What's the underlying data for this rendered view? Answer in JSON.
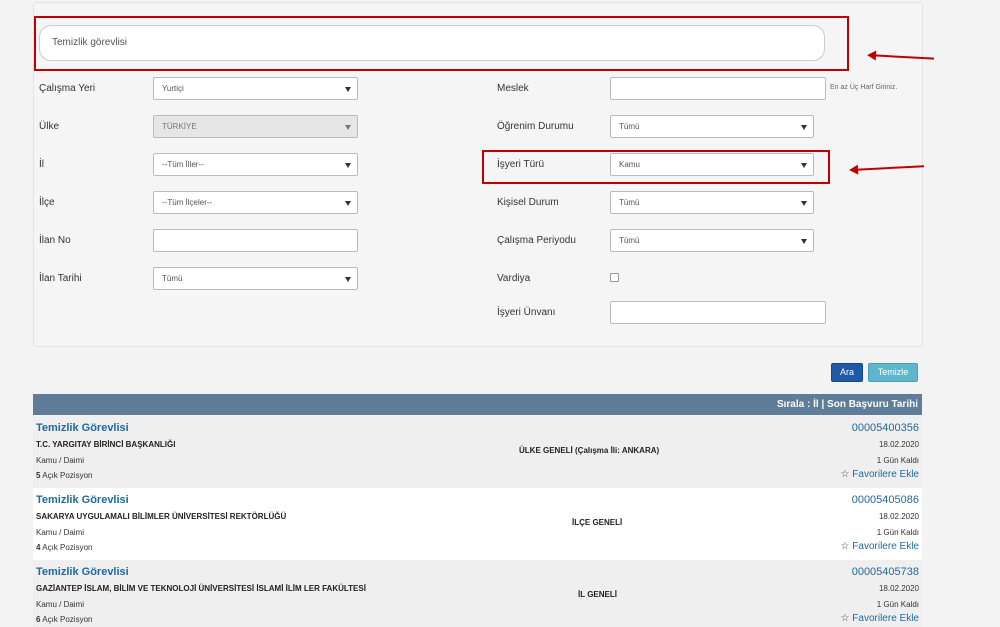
{
  "search": {
    "value": "Temizlik görevlisi"
  },
  "filters_left": [
    {
      "label": "Çalışma Yeri",
      "value": "Yurtiçi"
    },
    {
      "label": "Ülke",
      "value": "TÜRKİYE"
    },
    {
      "label": "İl",
      "value": "--Tüm İller--"
    },
    {
      "label": "İlçe",
      "value": "--Tüm İlçeler--"
    },
    {
      "label": "İlan No",
      "value": ""
    },
    {
      "label": "İlan Tarihi",
      "value": "Tümü"
    }
  ],
  "filters_right": [
    {
      "label": "Meslek",
      "value": "",
      "hint": "En az Üç Harf Giriniz."
    },
    {
      "label": "Öğrenim Durumu",
      "value": "Tümü"
    },
    {
      "label": "İşyeri Türü",
      "value": "Kamu"
    },
    {
      "label": "Kişisel Durum",
      "value": "Tümü"
    },
    {
      "label": "Çalışma Periyodu",
      "value": "Tümü"
    },
    {
      "label": "Vardiya",
      "value": ""
    },
    {
      "label": "İşyeri Ünvanı",
      "value": ""
    }
  ],
  "buttons": {
    "search": "Ara",
    "clear": "Temizle"
  },
  "results_header": {
    "sort_prefix": "Sırala :",
    "sort_il": "İl",
    "sort_sep": "|",
    "sort_date": "Son Başvuru Tarihi"
  },
  "results": [
    {
      "title": "Temizlik Görevlisi",
      "org": "T.C. YARGITAY BİRİNCİ BAŞKANLIĞI",
      "type": "Kamu / Daimi",
      "positions": "5",
      "positions_label": "Açık Pozisyon",
      "scope": "ÜLKE GENELİ (Çalışma İli: ANKARA)",
      "no": "00005400356",
      "date": "18.02.2020",
      "days_left": "1 Gün Kaldı",
      "fav": "Favorilere Ekle"
    },
    {
      "title": "Temizlik Görevlisi",
      "org": "SAKARYA UYGULAMALI BİLİMLER ÜNİVERSİTESİ REKTÖRLÜĞÜ",
      "type": "Kamu / Daimi",
      "positions": "4",
      "positions_label": "Açık Pozisyon",
      "scope": "İLÇE GENELİ",
      "no": "00005405086",
      "date": "18.02.2020",
      "days_left": "1 Gün Kaldı",
      "fav": "Favorilere Ekle"
    },
    {
      "title": "Temizlik Görevlisi",
      "org": "GAZİANTEP İSLAM, BİLİM VE TEKNOLOJİ ÜNİVERSİTESİ İSLAMİ İLİM LER FAKÜLTESİ",
      "type": "Kamu / Daimi",
      "positions": "6",
      "positions_label": "Açık Pozisyon",
      "scope": "İL GENELİ",
      "no": "00005405738",
      "date": "18.02.2020",
      "days_left": "1 Gün Kaldı",
      "fav": "Favorilere Ekle"
    }
  ]
}
